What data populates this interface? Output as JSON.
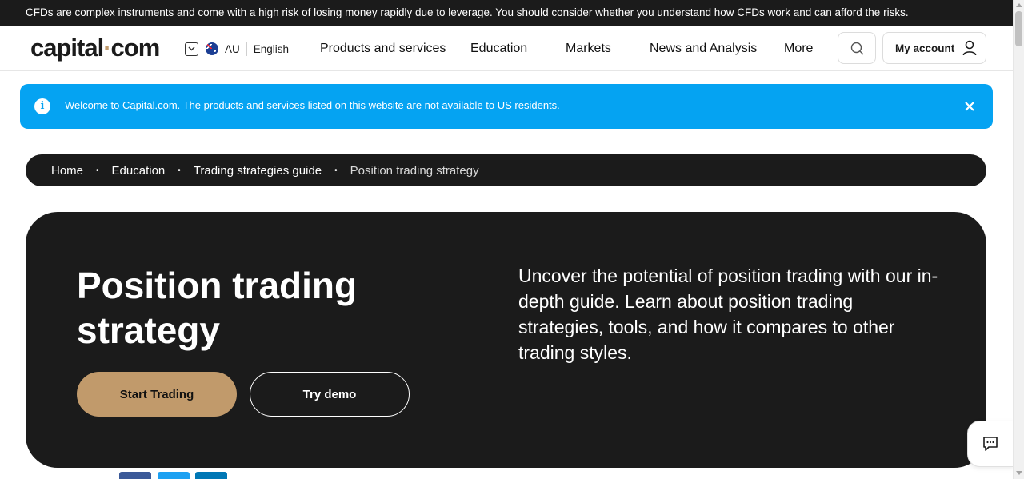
{
  "risk_warning": "CFDs are complex instruments and come with a high risk of losing money rapidly due to leverage. You should consider whether you understand how CFDs work and can afford the risks.",
  "header": {
    "logo_left": "capital",
    "logo_dot": "·",
    "logo_right": "com",
    "region_code": "AU",
    "language": "English",
    "nav": [
      "Products and services",
      "Education",
      "Markets",
      "News and Analysis",
      "More"
    ],
    "account_label": "My account"
  },
  "banner": {
    "info_glyph": "i",
    "message": "Welcome to Capital.com. The products and services listed on this website are not available to US residents."
  },
  "breadcrumb": {
    "items": [
      "Home",
      "Education",
      "Trading strategies guide"
    ],
    "current": "Position trading strategy",
    "separator": "•"
  },
  "hero": {
    "title": "Position trading strategy",
    "description": "Uncover the potential of position trading with our in-depth guide. Learn about position trading strategies, tools, and how it compares to other trading styles.",
    "primary_button": "Start Trading",
    "secondary_button": "Try demo"
  },
  "colors": {
    "brand_dark": "#1b1b1b",
    "brand_accent": "#c19a6b",
    "banner_blue": "#05a3f2",
    "share_facebook": "#3b5998",
    "share_twitter": "#1da1f2",
    "share_linkedin": "#0077b5"
  },
  "icons": {
    "search": "search-icon",
    "account": "user-icon",
    "close": "close-icon",
    "chat": "chat-icon",
    "chevron": "chevron-down-icon",
    "flag": "australia-flag-icon"
  }
}
